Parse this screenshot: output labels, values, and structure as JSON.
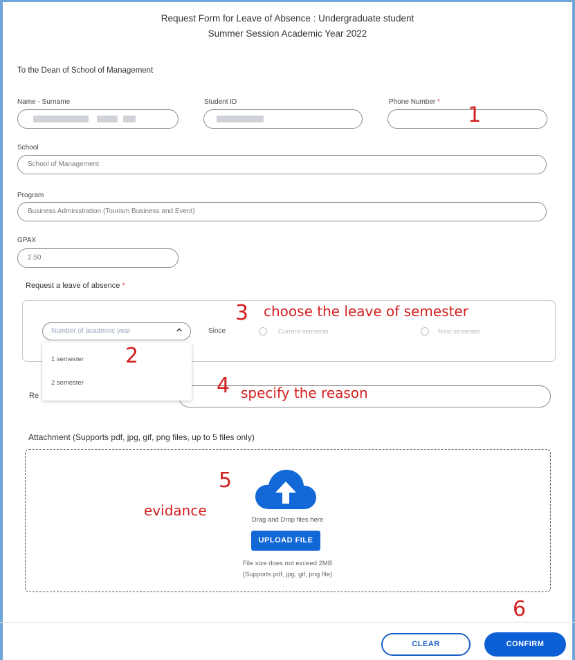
{
  "form": {
    "title_line1": "Request Form for Leave of Absence : Undergraduate student",
    "title_line2": "Summer Session  Academic Year 2022",
    "addressee": "To the Dean of School of Management",
    "name_label": "Name - Surname",
    "student_id_label": "Student ID",
    "phone_label": "Phone Number",
    "required_mark": "*",
    "school_label": "School",
    "school_value": "School of Management",
    "program_label": "Program",
    "program_value": "Business Administration (Tourism Business and Event)",
    "gpax_label": "GPAX",
    "gpax_value": "2.50",
    "request_label": "Request a leave of absence",
    "year_select_placeholder": "Number of academic year",
    "year_options": [
      "1 semester",
      "2 semester"
    ],
    "since_label": "Since",
    "radio_current": "Current semester",
    "radio_next": "Next semester",
    "reason_label": "Re",
    "attachment_label": "Attachment (Supports pdf, jpg, gif, png files, up to 5 files only)",
    "drag_text": "Drag and Drop files here",
    "upload_button": "UPLOAD FILE",
    "size_note": "File size does not exceed 2MB",
    "types_note": "(Supports pdf, jpg, gif, png file)",
    "clear_button": "CLEAR",
    "confirm_button": "CONFIRM"
  },
  "annotations": {
    "n1": "1",
    "n2": "2",
    "n3": "3",
    "n3_text": "choose the leave of  semester",
    "n4": "4",
    "n4_text": "specify the reason",
    "n5": "5",
    "n5_text": "evidance",
    "n6": "6"
  },
  "colors": {
    "annotation": "#d41f1f",
    "primary": "#0d5fd6",
    "required": "#e23b3b"
  }
}
